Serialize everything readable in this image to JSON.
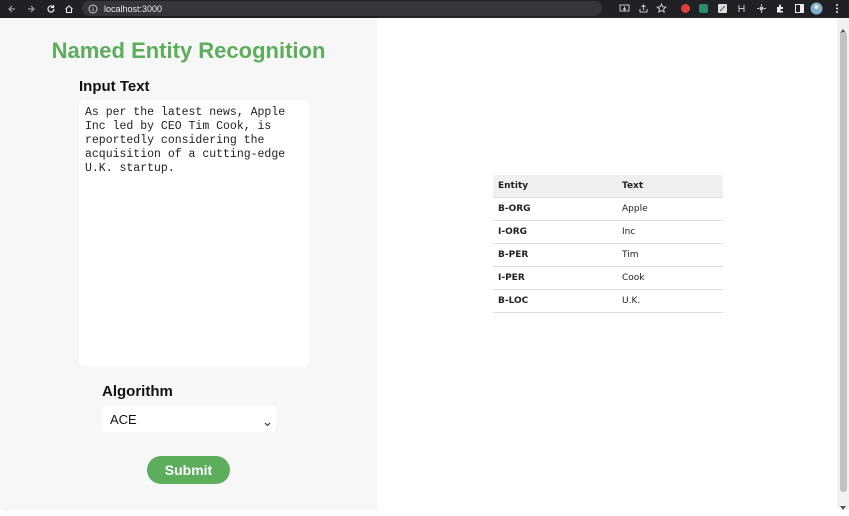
{
  "browser": {
    "url": "localhost:3000",
    "icons": [
      "back-icon",
      "forward-icon",
      "reload-icon",
      "home-icon",
      "info-icon",
      "install-icon",
      "share-icon",
      "bookmark-star-icon",
      "extension-icon",
      "puzzle-icon",
      "sidebar-icon",
      "profile-avatar",
      "menu-dots-icon"
    ]
  },
  "page": {
    "title": "Named Entity Recognition",
    "input_label": "Input Text",
    "input_text": "As per the latest news, Apple Inc led by CEO Tim Cook, is reportedly considering the acquisition of a cutting-edge U.K. startup.",
    "algorithm_label": "Algorithm",
    "algorithm_selected": "ACE",
    "submit_label": "Submit"
  },
  "results": {
    "headers": [
      "Entity",
      "Text"
    ],
    "rows": [
      {
        "entity": "B-ORG",
        "text": "Apple"
      },
      {
        "entity": "I-ORG",
        "text": "Inc"
      },
      {
        "entity": "B-PER",
        "text": "Tim"
      },
      {
        "entity": "I-PER",
        "text": "Cook"
      },
      {
        "entity": "B-LOC",
        "text": "U.K."
      }
    ]
  },
  "colors": {
    "accent": "#5cad5c",
    "chrome": "#202124",
    "panel": "#f7f7f7"
  }
}
